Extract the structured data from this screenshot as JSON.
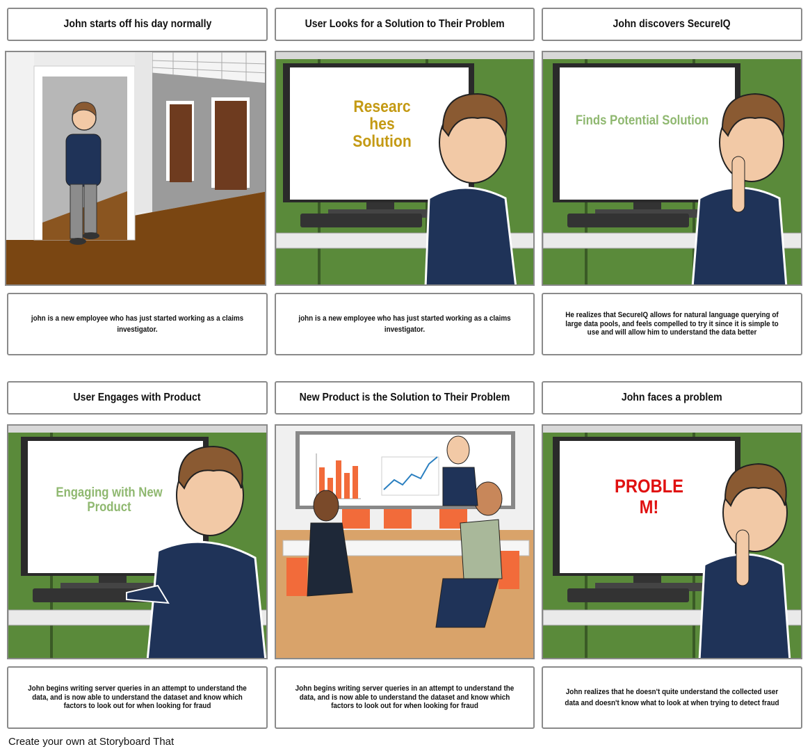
{
  "storyboard": {
    "panels": [
      {
        "title": "John starts off his day normally",
        "scene": "office-hallway",
        "screen_text": "",
        "caption": "john is a new employee who has just started working as a claims investigator."
      },
      {
        "title": "User Looks for a Solution to Their Problem",
        "scene": "computer-screen",
        "screen_text_lines": [
          "Researc",
          "hes",
          "Solution"
        ],
        "screen_text_color": "#c49a14",
        "caption": "john is a new employee who has just started working as a claims investigator."
      },
      {
        "title": "John discovers SecureIQ",
        "scene": "computer-screen",
        "screen_text_lines": [
          "Finds Potential Solution"
        ],
        "screen_text_color": "#8fb870",
        "caption": "He realizes that SecureIQ allows for natural language querying of large data pools, and feels compelled to try it since it is simple to use and will allow him to understand the data better"
      },
      {
        "title": "User Engages with Product",
        "scene": "computer-screen",
        "screen_text_lines": [
          "Engaging with New",
          "Product"
        ],
        "screen_text_color": "#8fb870",
        "caption": "John begins writing server queries in an attempt to understand the data, and is now able to understand the dataset and know which factors to look out for when looking for fraud"
      },
      {
        "title": "New Product is the Solution to Their Problem",
        "scene": "meeting-room",
        "screen_text_lines": [],
        "caption": "John begins writing server queries in an attempt to understand the data, and is now able to understand the dataset and know which factors to look out for when looking for fraud"
      },
      {
        "title": "John faces a problem",
        "scene": "computer-screen",
        "screen_text_lines": [
          "PROBLE",
          "M!"
        ],
        "screen_text_color": "#e01010",
        "caption": "John realizes that he doesn't quite understand the collected user data and doesn't know what to look at when trying to detect fraud"
      }
    ]
  },
  "footer": {
    "text": "Create your own at Storyboard That"
  },
  "colors": {
    "wall_green": "#5a8a3a",
    "shirt_navy": "#1f3358",
    "hair_brown": "#8a5a32",
    "skin": "#f2c9a6",
    "floor_brown": "#7a4612",
    "chart_orange": "#f26b3a"
  }
}
